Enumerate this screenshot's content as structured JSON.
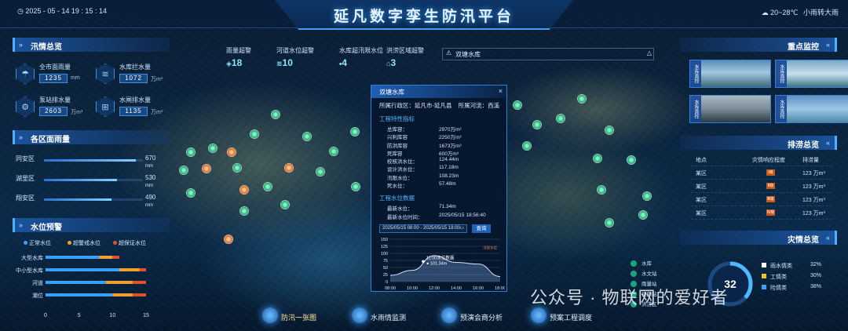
{
  "header": {
    "datetime": "2025 - 05 - 14   19 : 15 : 14",
    "title": "延凡数字孪生防汛平台",
    "weather_temp": "20~28℃",
    "weather_desc": "小雨转大雨"
  },
  "flood_overview": {
    "title": "汛情总览",
    "stats": [
      {
        "label": "全市面雨量",
        "value": "1235",
        "unit": "mm",
        "icon": "rain-icon"
      },
      {
        "label": "水库拦水量",
        "value": "1072",
        "unit": "万m³",
        "icon": "reservoir-icon"
      },
      {
        "label": "泵站排水量",
        "value": "2603",
        "unit": "万m³",
        "icon": "pump-icon"
      },
      {
        "label": "水闸排水量",
        "value": "1135",
        "unit": "万m³",
        "icon": "sluice-icon"
      }
    ]
  },
  "district_rainfall": {
    "title": "各区面雨量",
    "rows": [
      {
        "name": "同安区",
        "value": "670",
        "unit": "mm",
        "fraction": 0.93
      },
      {
        "name": "湖里区",
        "value": "530",
        "unit": "mm",
        "fraction": 0.74
      },
      {
        "name": "翔安区",
        "value": "490",
        "unit": "mm",
        "fraction": 0.68
      }
    ]
  },
  "water_level": {
    "title": "水位预警",
    "legend": [
      {
        "name": "正常水位",
        "color": "#3aa0ff"
      },
      {
        "name": "超警戒水位",
        "color": "#f0a030"
      },
      {
        "name": "超保证水位",
        "color": "#e05030"
      }
    ]
  },
  "chart_data": [
    {
      "type": "bar",
      "orientation": "horizontal",
      "categories": [
        "大型水库",
        "中小型水库",
        "河道",
        "潮位"
      ],
      "series": [
        {
          "name": "正常水位",
          "values": [
            8,
            11,
            9,
            10
          ]
        },
        {
          "name": "超警戒水位",
          "values": [
            2,
            3,
            4,
            3
          ]
        },
        {
          "name": "超保证水位",
          "values": [
            1,
            1,
            2,
            2
          ]
        }
      ],
      "xticks": [
        "0",
        "5",
        "10",
        "15"
      ],
      "xlim": [
        0,
        15
      ]
    },
    {
      "type": "area",
      "x": [
        "08:00",
        "10:00",
        "12:00",
        "14:00",
        "16:00",
        "18:00"
      ],
      "values": [
        22,
        40,
        92,
        68,
        62,
        18
      ],
      "yticks": [
        "0",
        "25",
        "50",
        "75",
        "100",
        "125",
        "150"
      ],
      "ylim": [
        0,
        150
      ],
      "annotation": "11:00水位数据",
      "annotation_value": "101.34m",
      "threshold_label": "汛限水位"
    }
  ],
  "top_stats": [
    {
      "label": "雨量超警",
      "value": "18"
    },
    {
      "label": "河道水位超警",
      "value": "10"
    },
    {
      "label": "水库超汛限水位",
      "value": "4"
    },
    {
      "label": "洪涝区域超警",
      "value": "3"
    }
  ],
  "alert": {
    "text": "双塘水库"
  },
  "popup": {
    "title": "双塘水库",
    "close": "×",
    "district": "所属行政区：延凡市-延凡县",
    "river": "所属河流：西溪",
    "section1": "工程特性指标",
    "specs": [
      {
        "k": "总库容：",
        "v": "2970万m³"
      },
      {
        "k": "兴利库容",
        "v": "2250万m³"
      },
      {
        "k": "防洪库容",
        "v": "1673万m³"
      },
      {
        "k": "死库容",
        "v": "600万m³"
      },
      {
        "k": "校核洪水位：",
        "v": "124.44m"
      },
      {
        "k": "设计洪水位：",
        "v": "117.18m"
      },
      {
        "k": "汛限水位：",
        "v": "108.23m"
      },
      {
        "k": "死水位：",
        "v": "57.48m"
      }
    ],
    "section2": "工程水位数据",
    "latest": [
      {
        "k": "最新水位：",
        "v": "71.34m"
      },
      {
        "k": "最新水位时间：",
        "v": "2025/05/15 18:56:40"
      }
    ],
    "query_range": "2025/05/15 08:00 - 2025/05/15 18:00",
    "query_btn": "查询"
  },
  "key_monitor": {
    "title": "重点监控",
    "tags": [
      "水库直控",
      "水库直控",
      "水库直控",
      "水库直控"
    ]
  },
  "drainage": {
    "title": "排涝总览",
    "headers": [
      "地点",
      "灾情响应程度",
      "排涝量"
    ],
    "rows": [
      {
        "place": "某区",
        "level": "Ⅰ级",
        "amount": "123 万m³"
      },
      {
        "place": "某区",
        "level": "Ⅱ级",
        "amount": "123 万m³"
      },
      {
        "place": "某区",
        "level": "Ⅲ级",
        "amount": "123 万m³"
      },
      {
        "place": "某区",
        "level": "Ⅳ级",
        "amount": "123 万m³"
      }
    ]
  },
  "disaster": {
    "title": "灾情总览",
    "center_value": "32",
    "items": [
      {
        "name": "雨水情类",
        "pct": "32%",
        "color": "#ffffff"
      },
      {
        "name": "工情类",
        "pct": "30%",
        "color": "#f0c030"
      },
      {
        "name": "险情类",
        "pct": "38%",
        "color": "#3aa0ff"
      }
    ]
  },
  "map_legend": [
    "水库",
    "水文站",
    "雨量站",
    "视频站",
    "洪涝区"
  ],
  "nav": [
    "防汛一张图",
    "水雨情监测",
    "预演会商分析",
    "预案工程调度"
  ],
  "watermark": "公众号 · 物联网的爱好者"
}
